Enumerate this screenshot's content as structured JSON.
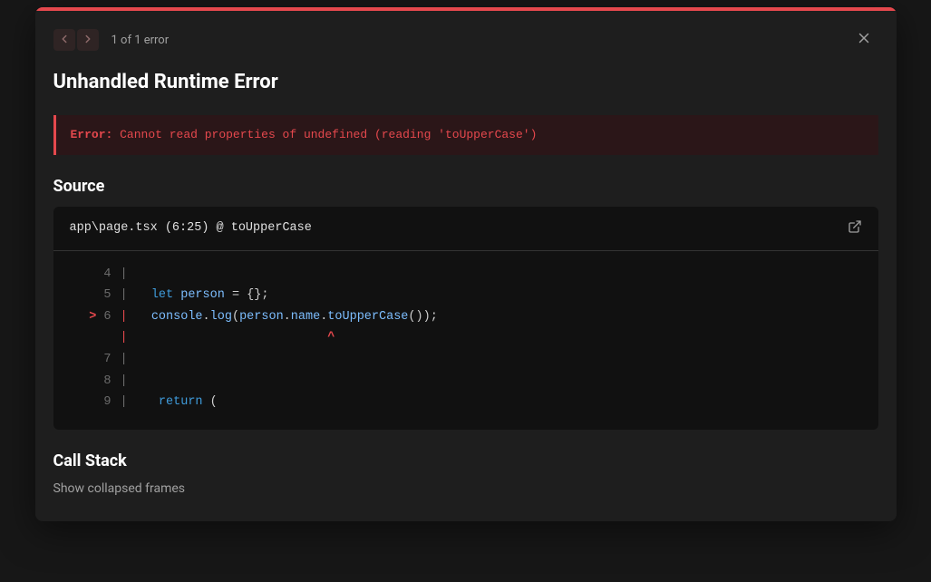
{
  "header": {
    "counter": "1 of 1 error"
  },
  "title": "Unhandled Runtime Error",
  "error": {
    "prefix": "Error:",
    "message": " Cannot read properties of undefined (reading 'toUpperCase')"
  },
  "source": {
    "section_title": "Source",
    "location_prefix": "app\\page.tsx (6:25) @ ",
    "function_name": "toUpperCase",
    "lines": [
      {
        "num": "4",
        "marker": " ",
        "tokens": []
      },
      {
        "num": "5",
        "marker": " ",
        "tokens": [
          {
            "cls": "tok-default",
            "txt": "  "
          },
          {
            "cls": "tok-keyword",
            "txt": "let"
          },
          {
            "cls": "tok-default",
            "txt": " "
          },
          {
            "cls": "tok-ident",
            "txt": "person"
          },
          {
            "cls": "tok-default",
            "txt": " = {};"
          }
        ]
      },
      {
        "num": "6",
        "marker": ">",
        "error": true,
        "tokens": [
          {
            "cls": "tok-default",
            "txt": "  "
          },
          {
            "cls": "tok-ident",
            "txt": "console"
          },
          {
            "cls": "tok-default",
            "txt": "."
          },
          {
            "cls": "tok-ident",
            "txt": "log"
          },
          {
            "cls": "tok-default",
            "txt": "("
          },
          {
            "cls": "tok-ident",
            "txt": "person"
          },
          {
            "cls": "tok-default",
            "txt": "."
          },
          {
            "cls": "tok-ident",
            "txt": "name"
          },
          {
            "cls": "tok-default",
            "txt": "."
          },
          {
            "cls": "tok-ident",
            "txt": "toUpperCase"
          },
          {
            "cls": "tok-default",
            "txt": "());"
          }
        ]
      },
      {
        "num": "",
        "marker": " ",
        "error": true,
        "caret": true,
        "tokens": [
          {
            "cls": "",
            "txt": "                          ^"
          }
        ]
      },
      {
        "num": "7",
        "marker": " ",
        "tokens": []
      },
      {
        "num": "8",
        "marker": " ",
        "tokens": []
      },
      {
        "num": "9",
        "marker": " ",
        "tokens": [
          {
            "cls": "tok-default",
            "txt": "   "
          },
          {
            "cls": "tok-return",
            "txt": "return"
          },
          {
            "cls": "tok-default",
            "txt": " ("
          }
        ]
      }
    ]
  },
  "callstack": {
    "section_title": "Call Stack",
    "toggle_label": "Show collapsed frames"
  }
}
